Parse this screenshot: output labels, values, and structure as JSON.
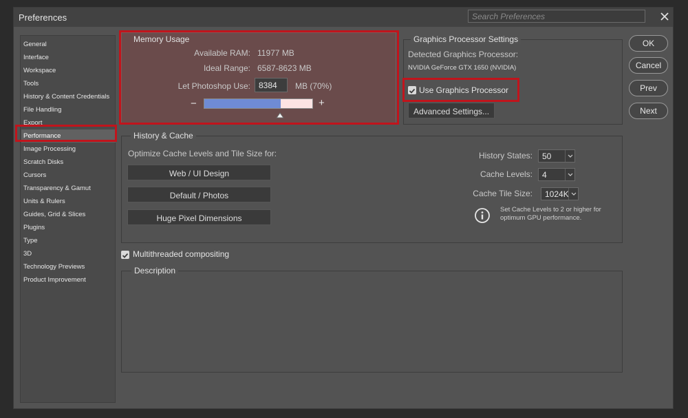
{
  "window": {
    "title": "Preferences",
    "search_placeholder": "Search Preferences"
  },
  "sidebar": {
    "items": [
      {
        "label": "General"
      },
      {
        "label": "Interface"
      },
      {
        "label": "Workspace"
      },
      {
        "label": "Tools"
      },
      {
        "label": "History & Content Credentials"
      },
      {
        "label": "File Handling"
      },
      {
        "label": "Export"
      },
      {
        "label": "Performance",
        "selected": true
      },
      {
        "label": "Image Processing"
      },
      {
        "label": "Scratch Disks"
      },
      {
        "label": "Cursors"
      },
      {
        "label": "Transparency & Gamut"
      },
      {
        "label": "Units & Rulers"
      },
      {
        "label": "Guides, Grid & Slices"
      },
      {
        "label": "Plugins"
      },
      {
        "label": "Type"
      },
      {
        "label": "3D"
      },
      {
        "label": "Technology Previews"
      },
      {
        "label": "Product Improvement"
      }
    ]
  },
  "memory": {
    "title": "Memory Usage",
    "available_label": "Available RAM:",
    "available_value": "11977 MB",
    "ideal_label": "Ideal Range:",
    "ideal_value": "6587-8623 MB",
    "let_label": "Let Photoshop Use:",
    "let_value": "8384",
    "let_unit": "MB (70%)",
    "slider_fraction": 0.7,
    "minus": "−",
    "plus": "+"
  },
  "gpu": {
    "title": "Graphics Processor Settings",
    "detected_label": "Detected Graphics Processor:",
    "detected_value": "NVIDIA GeForce GTX 1650 (NVIDIA)",
    "use_label": "Use Graphics Processor",
    "use_checked": true,
    "advanced_label": "Advanced Settings..."
  },
  "history": {
    "title": "History & Cache",
    "optimize_label": "Optimize Cache Levels and Tile Size for:",
    "buttons": [
      "Web / UI Design",
      "Default / Photos",
      "Huge Pixel Dimensions"
    ],
    "states_label": "History States:",
    "states_value": "50",
    "levels_label": "Cache Levels:",
    "levels_value": "4",
    "tile_label": "Cache Tile Size:",
    "tile_value": "1024K",
    "info_text": "Set Cache Levels to 2 or higher for optimum GPU performance."
  },
  "multithreaded": {
    "label": "Multithreaded compositing",
    "checked": true
  },
  "description": {
    "title": "Description"
  },
  "buttons": {
    "ok": "OK",
    "cancel": "Cancel",
    "prev": "Prev",
    "next": "Next"
  },
  "colors": {
    "highlight": "#c1141c",
    "slider_fill": "#6f8bd5",
    "slider_empty": "#fde3e3"
  }
}
